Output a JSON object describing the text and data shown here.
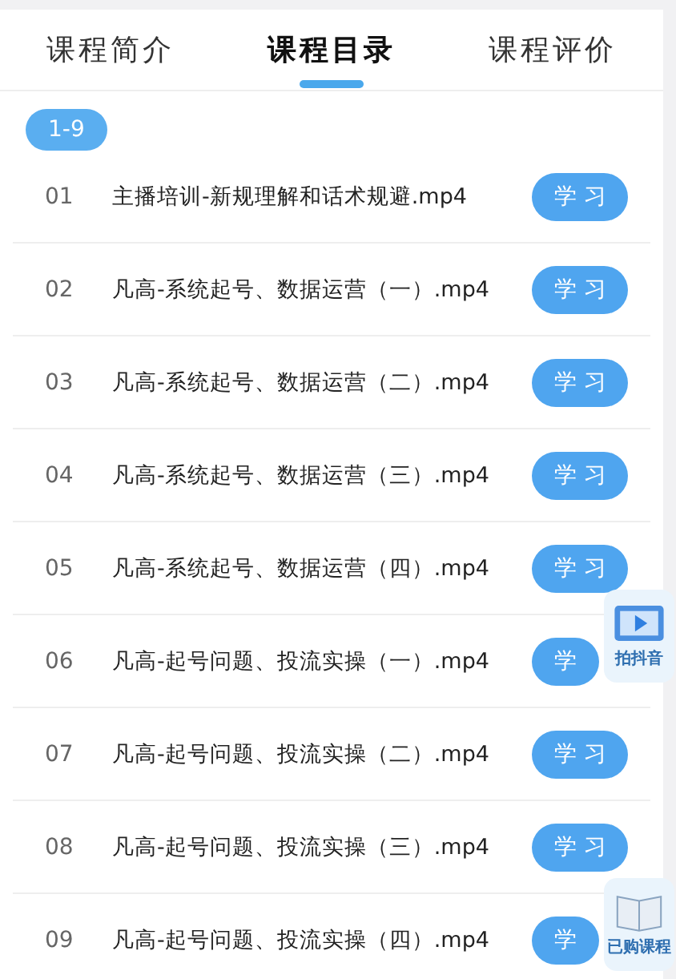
{
  "tabs": [
    {
      "label": "课程简介",
      "selected": false
    },
    {
      "label": "课程目录",
      "selected": true
    },
    {
      "label": "课程评价",
      "selected": false
    }
  ],
  "range_chip": "1-9",
  "lessons": [
    {
      "number": "01",
      "title": "主播培训-新规理解和话术规避.mp4",
      "action": "学 习"
    },
    {
      "number": "02",
      "title": "凡高-系统起号、数据运营（一）.mp4",
      "action": "学 习"
    },
    {
      "number": "03",
      "title": "凡高-系统起号、数据运营（二）.mp4",
      "action": "学 习"
    },
    {
      "number": "04",
      "title": "凡高-系统起号、数据运营（三）.mp4",
      "action": "学 习"
    },
    {
      "number": "05",
      "title": "凡高-系统起号、数据运营（四）.mp4",
      "action": "学 习"
    },
    {
      "number": "06",
      "title": "凡高-起号问题、投流实操（一）.mp4",
      "action": "学"
    },
    {
      "number": "07",
      "title": "凡高-起号问题、投流实操（二）.mp4",
      "action": "学 习"
    },
    {
      "number": "08",
      "title": "凡高-起号问题、投流实操（三）.mp4",
      "action": "学 习"
    },
    {
      "number": "09",
      "title": "凡高-起号问题、投流实操（四）.mp4",
      "action": "学"
    }
  ],
  "floating_buttons": [
    {
      "kind": "video",
      "label": "拍抖音"
    },
    {
      "kind": "book",
      "label": "已购课程"
    }
  ]
}
